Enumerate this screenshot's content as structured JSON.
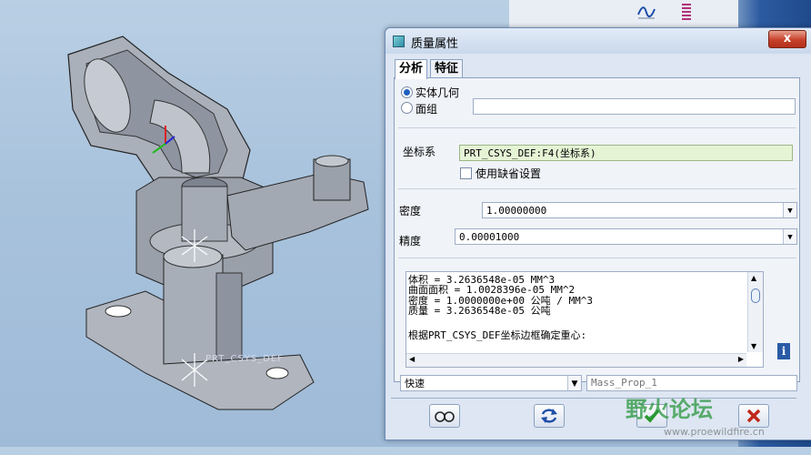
{
  "dialog": {
    "title": "质量属性",
    "close_label": "x",
    "tabs": [
      {
        "label": "分析"
      },
      {
        "label": "特征"
      }
    ],
    "geometry_options": [
      {
        "label": "实体几何",
        "selected": true
      },
      {
        "label": "面组",
        "selected": false
      }
    ],
    "quilt_value": "",
    "csys_label": "坐标系",
    "csys_value": "PRT_CSYS_DEF:F4(坐标系)",
    "use_default_label": "使用缺省设置",
    "use_default_checked": false,
    "density_label": "密度",
    "density_value": "1.00000000",
    "accuracy_label": "精度",
    "accuracy_value": "0.00001000",
    "results": [
      "体积 =  3.2636548e-05  MM^3",
      "曲面面积 =  1.0028396e-05  MM^2",
      "密度 =  1.0000000e+00 公吨 / MM^3",
      "质量 =  3.2636548e-05 公吨",
      "",
      "根据PRT_CSYS_DEF坐标边框确定重心:"
    ],
    "mode_value": "快速",
    "name_placeholder": "Mass_Prop_1"
  },
  "model": {
    "csys_label": "PRT_CSYS_DEF"
  },
  "watermark": {
    "text": "野火论坛",
    "url": "www.proewildfire.cn"
  },
  "colors": {
    "accent": "#1f5fbf",
    "ok_green": "#2a9a2a",
    "cancel_red": "#c0281a",
    "part_gray": "#a9aeb8"
  },
  "icons": [
    "curve-analysis-icon",
    "spring-icon",
    "glasses-icon",
    "repeat-icon",
    "check-icon",
    "cancel-icon",
    "info-icon"
  ]
}
